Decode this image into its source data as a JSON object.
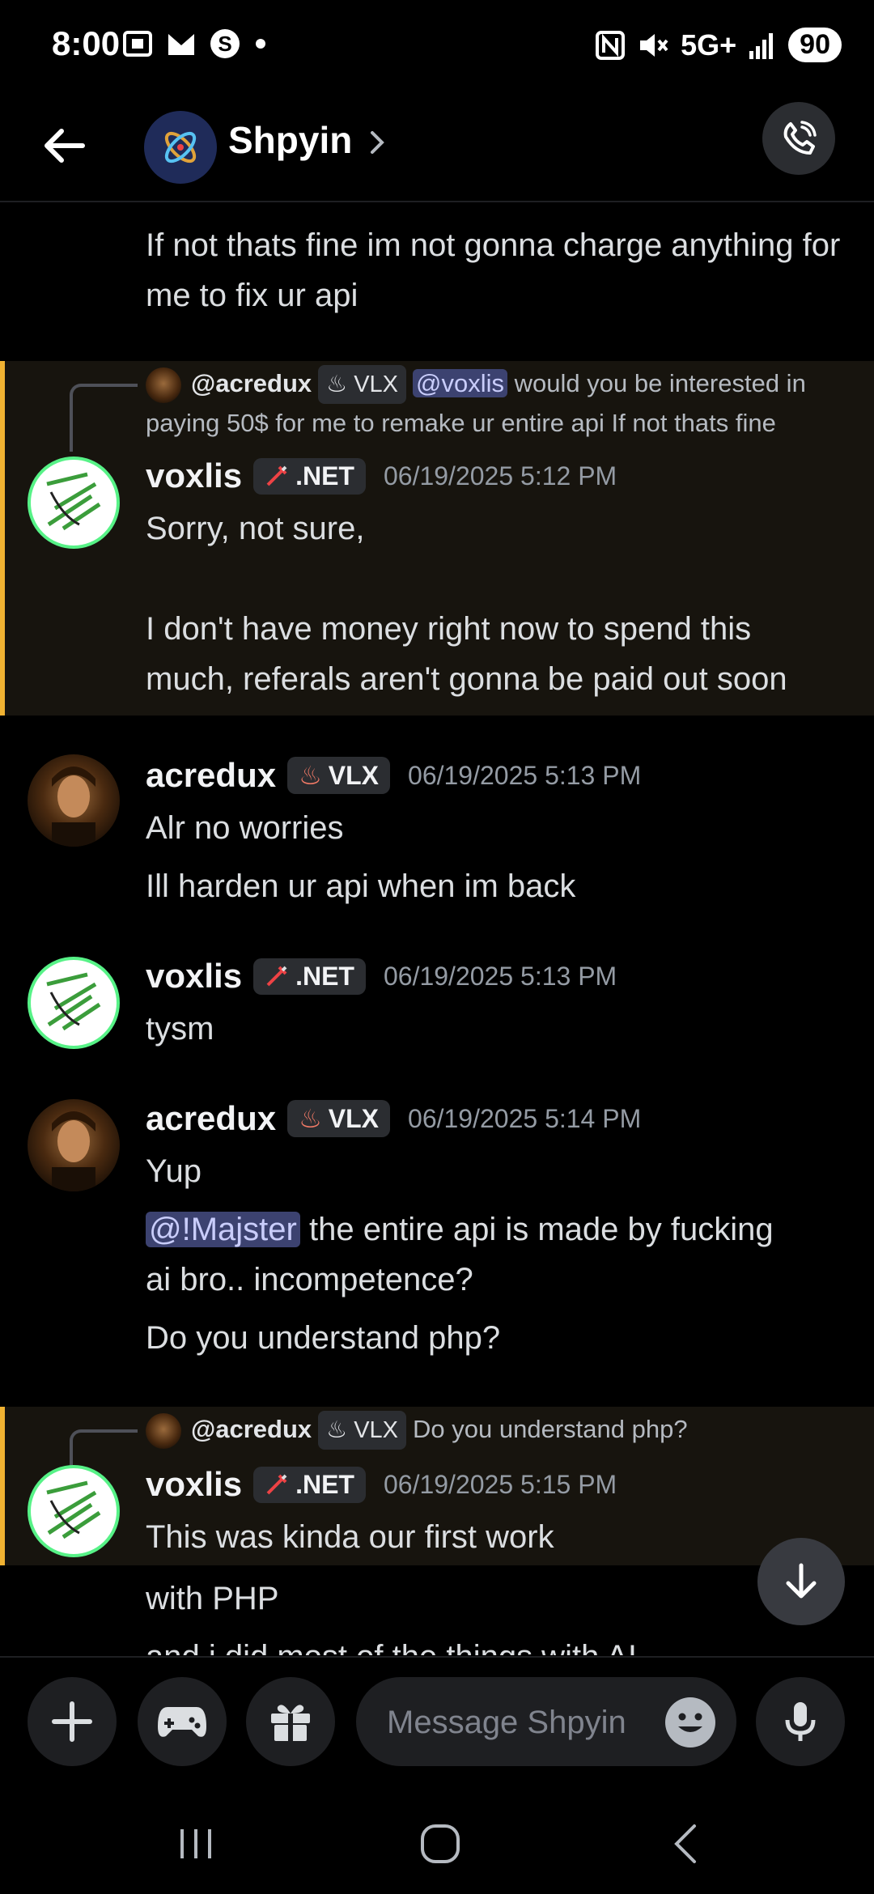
{
  "status_bar": {
    "time": "8:00",
    "network": "5G+",
    "battery": "90"
  },
  "header": {
    "channel_name": "Shpyin"
  },
  "messages": {
    "top_text": "If not thats fine im not gonna charge anything for me to fix ur api",
    "m1": {
      "reply_user": "@acredux",
      "reply_tag": "VLX",
      "reply_mention": "@voxlis",
      "reply_text_1": " would you be interested in",
      "reply_text_2": "paying 50$ for me to remake ur entire api  If not thats fine",
      "author": "voxlis",
      "tag": ".NET",
      "timestamp": "06/19/2025 5:12 PM",
      "line1": "Sorry, not sure,",
      "line2": "I don't have money right now to spend this",
      "line3": "much, referals aren't gonna be paid out soon"
    },
    "m2": {
      "author": "acredux",
      "tag": "VLX",
      "timestamp": "06/19/2025 5:13 PM",
      "line1": "Alr no worries",
      "line2": "Ill harden ur api when im back"
    },
    "m3": {
      "author": "voxlis",
      "tag": ".NET",
      "timestamp": "06/19/2025 5:13 PM",
      "line1": "tysm"
    },
    "m4": {
      "author": "acredux",
      "tag": "VLX",
      "timestamp": "06/19/2025 5:14 PM",
      "line1": "Yup",
      "mention": "@!Majster",
      "line2a": " the entire api is made by fucking",
      "line2b": "ai bro.. incompetence?",
      "line3": "Do you understand php?"
    },
    "m5": {
      "reply_user": "@acredux",
      "reply_tag": "VLX",
      "reply_text": "Do you understand php?",
      "author": "voxlis",
      "tag": ".NET",
      "timestamp": "06/19/2025 5:15 PM",
      "line1": "This was kinda our first work",
      "line2": "with PHP",
      "line3": "and i did most of the things with AI"
    }
  },
  "composer": {
    "placeholder": "Message Shpyin"
  },
  "colors": {
    "accent_bar": "#f0b232",
    "mention_bg": "#3c4270",
    "online": "#57f287"
  }
}
